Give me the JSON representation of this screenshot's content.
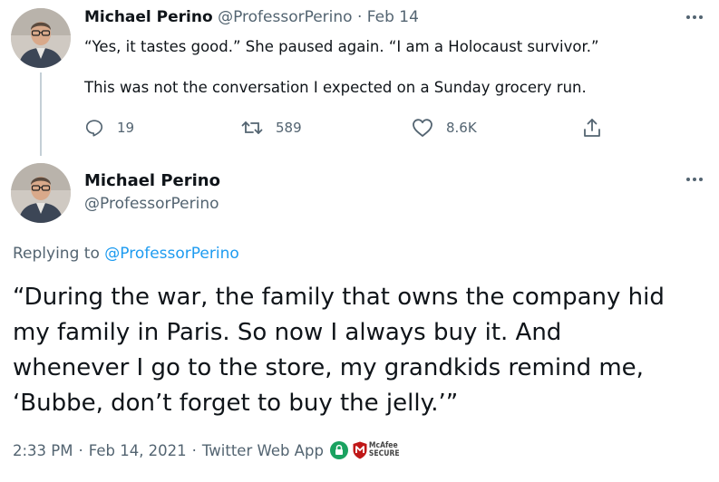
{
  "tweet1": {
    "author_name": "Michael Perino",
    "handle": "@ProfessorPerino",
    "separator": "·",
    "date": "Feb 14",
    "text_line1": "“Yes, it tastes good.” She paused again. “I am a Holocaust survivor.”",
    "text_line2": "This was not the conversation I expected on a Sunday grocery run.",
    "actions": {
      "reply_count": "19",
      "retweet_count": "589",
      "like_count": "8.6K"
    }
  },
  "tweet2": {
    "author_name": "Michael Perino",
    "handle": "@ProfessorPerino",
    "replying_prefix": "Replying to",
    "replying_to": "@ProfessorPerino",
    "text_lines": [
      "“During the war, the family that owns the company hid",
      "my family in Paris. So now I always buy it. And",
      "whenever I go to the store, my grandkids remind me,",
      "‘Bubbe, don’t forget to buy the jelly.’”"
    ],
    "time": "2:33 PM",
    "date": "Feb 14, 2021",
    "source": "Twitter Web App",
    "dot": "·",
    "badge_line1": "McAfee",
    "badge_line2": "SECURE"
  },
  "icons": {
    "reply": "reply-icon",
    "retweet": "retweet-icon",
    "like": "heart-icon",
    "share": "share-icon",
    "more": "more-icon",
    "lock": "lock-icon",
    "mcafee": "mcafee-shield-icon"
  },
  "colors": {
    "text": "#0f1419",
    "muted": "#536471",
    "link": "#1d9bf0",
    "thread_line": "#c4cfd6",
    "lock_green": "#1aa260",
    "mcafee_red": "#c01818"
  }
}
